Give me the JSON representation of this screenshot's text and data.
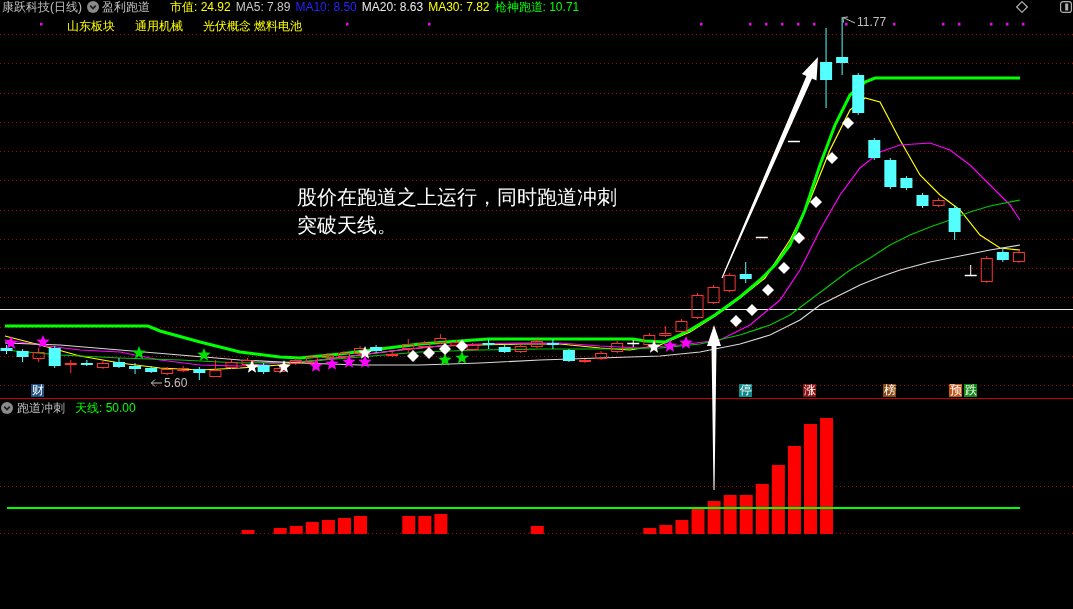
{
  "header": {
    "title": "康跃科技(日线)",
    "formula": "盈利跑道",
    "readings": [
      {
        "label": "市值: 24.92",
        "color": "#ffff00"
      },
      {
        "label": "MA5: 7.89",
        "color": "#c8c8c8"
      },
      {
        "label": "MA10: 8.50",
        "color": "#2424ff"
      },
      {
        "label": "MA20: 8.63",
        "color": "#ececec"
      },
      {
        "label": "MA30: 7.82",
        "color": "#ffff00"
      },
      {
        "label": "枪神跑道: 10.71",
        "color": "#00ff00"
      }
    ]
  },
  "concepts": [
    "山东板块",
    "通用机械",
    "光伏概念 燃料电池"
  ],
  "chart": {
    "annotation": "股价在跑道之上运行，同时跑道冲刺突破天线。",
    "high_label": "11.77",
    "low_label": "5.60",
    "markers": [
      {
        "label": "财",
        "color": "#1c4f80"
      },
      {
        "label": "停",
        "color": "#128a8a"
      },
      {
        "label": "涨",
        "color": "#8a1212"
      },
      {
        "label": "榜",
        "color": "#8b4a12"
      },
      {
        "label": "预",
        "color": "#c4561a"
      },
      {
        "label": "跌",
        "color": "#138a13"
      }
    ]
  },
  "indicator": {
    "title": "跑道冲刺",
    "reading": "天线: 50.00"
  }
}
